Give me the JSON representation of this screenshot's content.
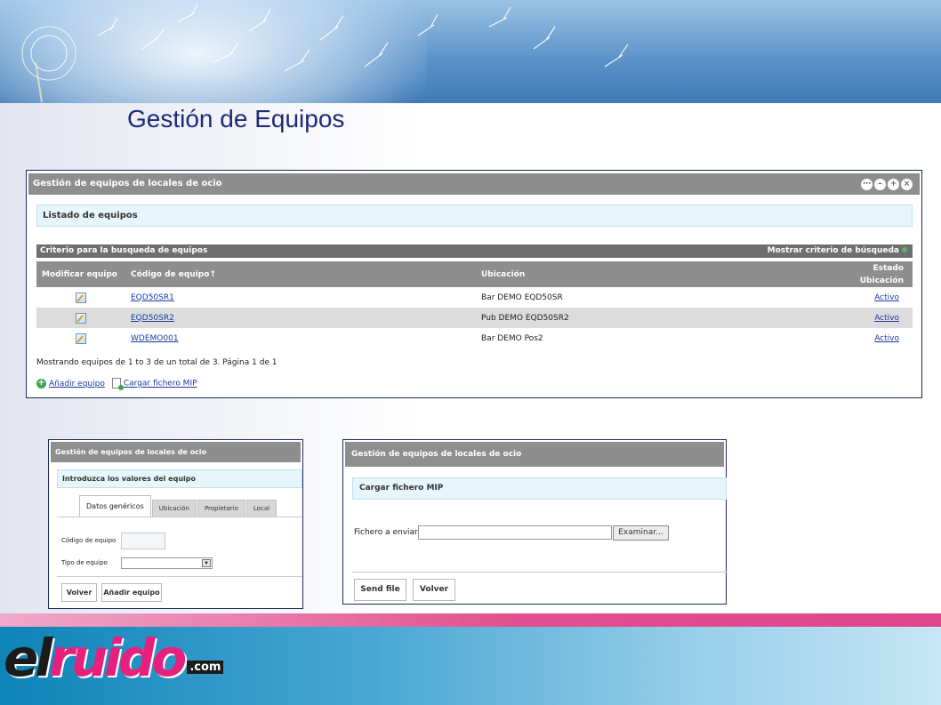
{
  "page": {
    "title": "Gestión de Equipos"
  },
  "main_panel": {
    "title": "Gestión de equipos de locales de ocio",
    "list_title": "Listado de equipos",
    "criteria_label": "Criterio para la busqueda de equipos",
    "criteria_toggle": "Mostrar criterio de búsqueda",
    "columns": {
      "edit": "Modificar equipo",
      "code": "Código de equipo↑",
      "location": "Ubicación",
      "state": "Estado",
      "state_sub": "Ubicación"
    },
    "rows": [
      {
        "code": "EQD50SR1",
        "location": "Bar DEMO EQD50SR",
        "state": "Activo"
      },
      {
        "code": "EQD50SR2",
        "location": "Pub DEMO EQD50SR2",
        "state": "Activo"
      },
      {
        "code": "WDEMO001",
        "location": "Bar DEMO Pos2",
        "state": "Activo"
      }
    ],
    "summary": "Mostrando equipos de 1 to 3 de un total de 3. Página 1 de 1",
    "add_link": "Añadir equipo",
    "upload_link": "Cargar fichero MIP"
  },
  "form_panel": {
    "title": "Gestión de equipos de locales de ocio",
    "intro": "Introduzca los valores del equipo",
    "tabs": [
      "Datos genéricos",
      "Ubicación",
      "Propietario",
      "Local"
    ],
    "code_label": "Código de equipo",
    "type_label": "Tipo de equipo",
    "code_value": "",
    "back_button": "Volver",
    "add_button": "Añadir equipo"
  },
  "upload_panel": {
    "title": "Gestión de equipos de locales de ocio",
    "heading": "Cargar fichero MIP",
    "file_label": "Fichero a enviar",
    "file_value": "",
    "browse_button": "Examinar...",
    "send_button": "Send file",
    "back_button": "Volver"
  },
  "footer": {
    "logo_part1": "el",
    "logo_part2": "ruido",
    "logo_part3": ".com"
  },
  "colors": {
    "title_blue": "#1e2a78",
    "panel_gray": "#8e8e8e",
    "note_bg": "#e7f5fc",
    "link_blue": "#1a3aa0",
    "footer_pink": "#e0468b",
    "footer_blue": "#0e84b8"
  }
}
